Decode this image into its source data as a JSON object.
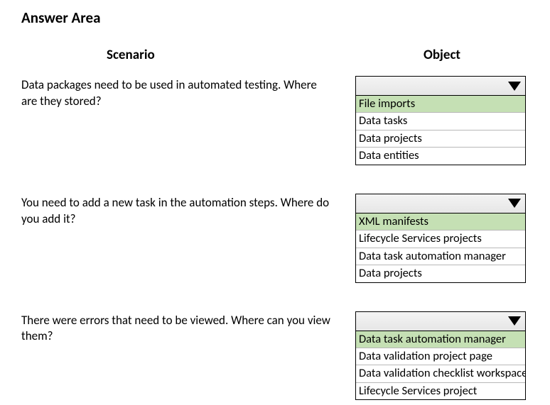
{
  "title": "Answer Area",
  "headers": {
    "scenario": "Scenario",
    "object": "Object"
  },
  "rows": [
    {
      "scenario": "Data packages need to be used in automated testing. Where are they stored?",
      "options": [
        "File imports",
        "Data tasks",
        "Data projects",
        "Data entities"
      ],
      "selected_index": 0
    },
    {
      "scenario": "You need to add a new task in the automation steps. Where do you add it?",
      "options": [
        "XML manifests",
        "Lifecycle Services projects",
        "Data task automation manager",
        "Data projects"
      ],
      "selected_index": 0
    },
    {
      "scenario": "There were errors that need to be viewed. Where can you view them?",
      "options": [
        "Data task automation  manager",
        "Data validation project page",
        "Data validation checklist workspace",
        "Lifecycle Services project"
      ],
      "selected_index": 0
    }
  ]
}
